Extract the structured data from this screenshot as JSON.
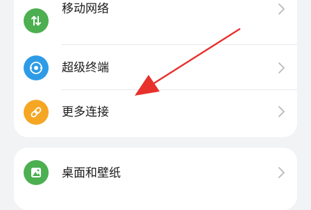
{
  "settings": {
    "items": [
      {
        "label": "移动网络",
        "icon": "mobile-data-icon",
        "color": "#4caf50"
      },
      {
        "label": "超级终端",
        "icon": "super-device-icon",
        "color": "#2e9be6"
      },
      {
        "label": "更多连接",
        "icon": "link-icon",
        "color": "#f5a623"
      },
      {
        "label": "桌面和壁纸",
        "icon": "wallpaper-icon",
        "color": "#4caf50"
      }
    ]
  },
  "annotation": {
    "color": "#e8302c"
  }
}
